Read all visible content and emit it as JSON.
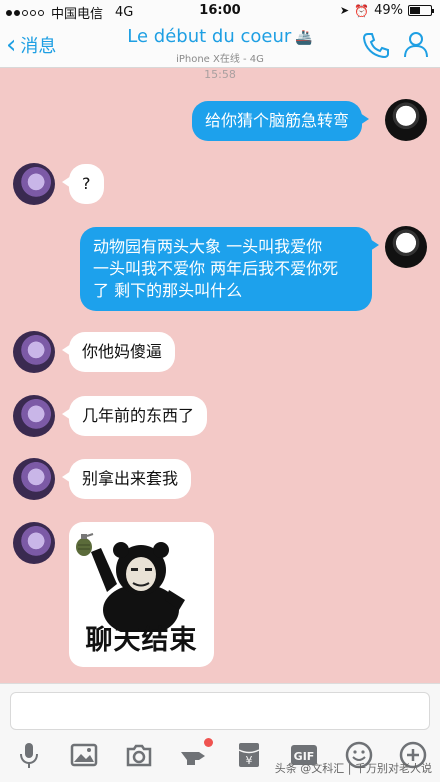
{
  "status": {
    "carrier": "中国电信",
    "network": "4G",
    "time": "16:00",
    "battery": "49%",
    "battery_level": 0.49
  },
  "nav": {
    "back_label": "消息",
    "title": "Le début du coeur",
    "subtitle": "iPhone X在线 - 4G"
  },
  "timestamp": "15:58",
  "messages": [
    {
      "from": "me",
      "text": "给你猜个脑筋急转弯"
    },
    {
      "from": "other",
      "text": "?"
    },
    {
      "from": "me",
      "lines": [
        "动物园有两头大象 一头叫我爱你",
        "一头叫我不爱你 两年后我不爱你死",
        "了 剩下的那头叫什么"
      ]
    },
    {
      "from": "other",
      "text": "你他妈傻逼"
    },
    {
      "from": "other",
      "text": "几年前的东西了"
    },
    {
      "from": "other",
      "text": "别拿出来套我"
    },
    {
      "from": "other",
      "sticker_text": "聊天结束"
    }
  ],
  "toolbar": {
    "icons": [
      "microphone-icon",
      "image-icon",
      "camera-icon",
      "shake-icon",
      "red-packet-icon",
      "gif-icon",
      "emoji-icon",
      "plus-icon"
    ],
    "gif_label": "GIF",
    "red_packet_label": "¥"
  },
  "watermark": "头条 @文科汇 | 千万别对老人说"
}
